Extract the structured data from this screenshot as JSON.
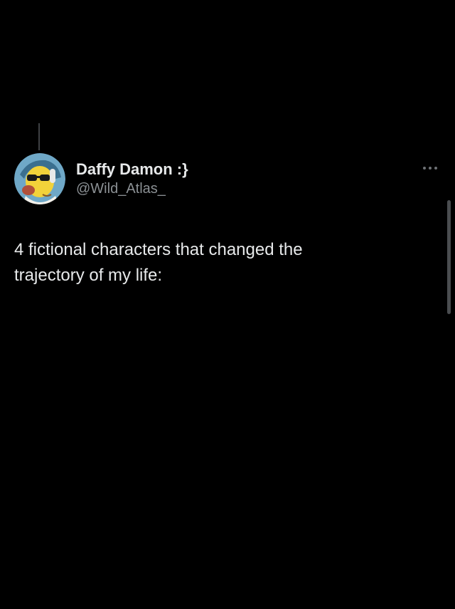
{
  "tweet": {
    "author": {
      "display_name": "Daffy Damon :}",
      "handle": "@Wild_Atlas_",
      "avatar_icon": "cartoon-character-avatar"
    },
    "more_icon": "more-options-icon",
    "text": "4 fictional characters that changed the\ntrajectory of my life:"
  },
  "colors": {
    "background": "#000000",
    "primary_text": "#e7e9ea",
    "secondary_text": "#8b9094"
  }
}
